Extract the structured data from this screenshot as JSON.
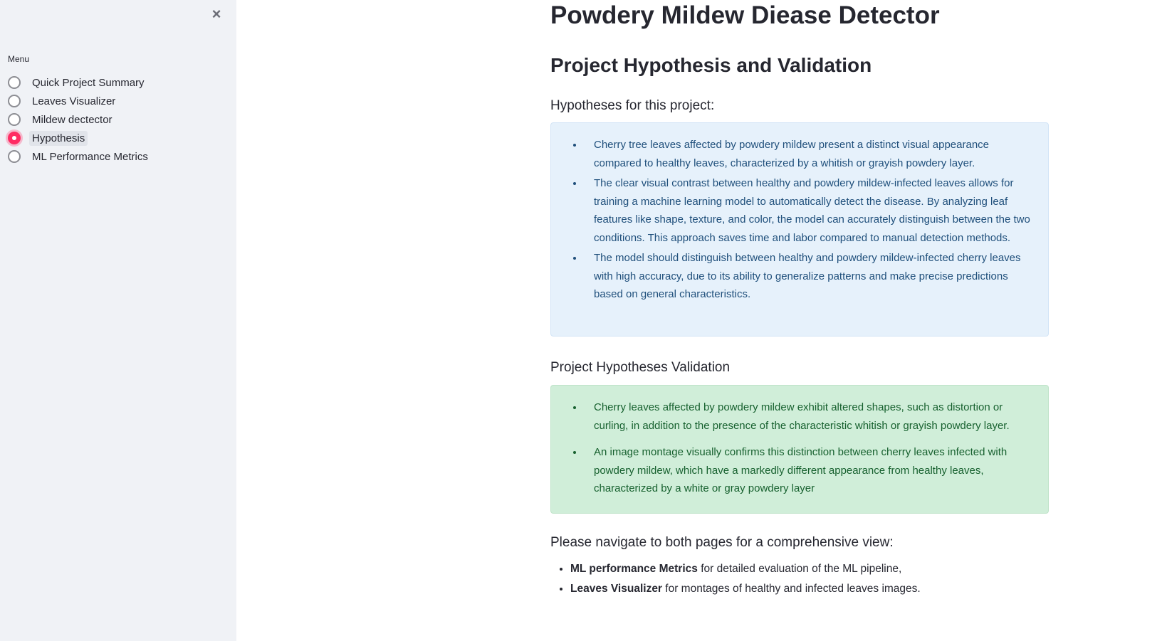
{
  "sidebar": {
    "close_icon": "×",
    "menu_label": "Menu",
    "items": [
      {
        "label": "Quick Project Summary",
        "selected": false
      },
      {
        "label": "Leaves Visualizer",
        "selected": false
      },
      {
        "label": "Mildew dectector",
        "selected": false
      },
      {
        "label": "Hypothesis",
        "selected": true
      },
      {
        "label": "ML Performance Metrics",
        "selected": false
      }
    ],
    "accent_color": "#ff2b63"
  },
  "main": {
    "title": "Powdery Mildew Diease Detector",
    "section_title": "Project Hypothesis and Validation",
    "hypotheses_heading": "Hypotheses for this project:",
    "hypotheses": [
      "Cherry tree leaves affected by powdery mildew present a distinct visual appearance compared to healthy leaves, characterized by a whitish or grayish powdery layer.",
      "The clear visual contrast between healthy and powdery mildew-infected leaves allows for training a machine learning model to automatically detect the disease. By analyzing leaf features like shape, texture, and color, the model can accurately distinguish between the two conditions. This approach saves time and labor compared to manual detection methods.",
      "The model should distinguish between healthy and powdery mildew-infected cherry leaves with high accuracy, due to its ability to generalize patterns and make precise predictions based on general characteristics."
    ],
    "validation_heading": "Project Hypotheses Validation",
    "validation": [
      "Cherry leaves affected by powdery mildew exhibit altered shapes, such as distortion or curling, in addition to the presence of the characteristic whitish or grayish powdery layer.",
      "An image montage visually confirms this distinction between cherry leaves infected with powdery mildew, which have a markedly different appearance from healthy leaves, characterized by a white or gray powdery layer"
    ],
    "navigate_heading": "Please navigate to both pages for a comprehensive view:",
    "navigate_items": [
      {
        "bold": "ML performance Metrics",
        "text": " for detailed evaluation of the ML pipeline,"
      },
      {
        "bold": "Leaves Visualizer",
        "text": " for montages of healthy and infected leaves images."
      }
    ],
    "info_color": "#e6f1fb",
    "success_color": "#d0eed9"
  }
}
